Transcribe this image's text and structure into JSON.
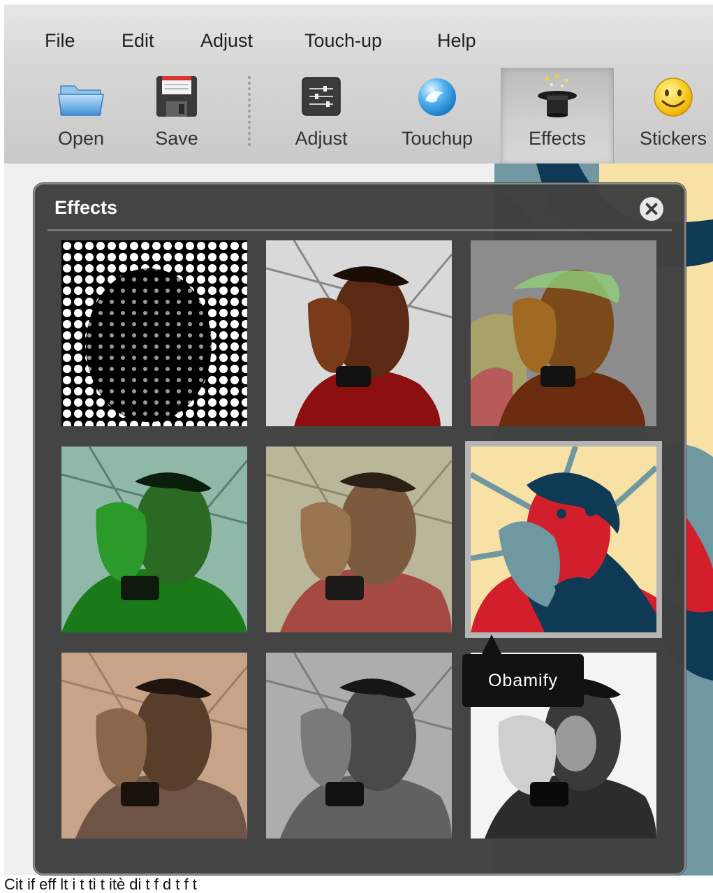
{
  "menu": {
    "items": [
      "File",
      "Edit",
      "Adjust",
      "Touch-up",
      "Help"
    ]
  },
  "toolbar": {
    "tools": [
      {
        "label": "Open",
        "icon": "folder-open-icon"
      },
      {
        "label": "Save",
        "icon": "floppy-disk-icon"
      },
      {
        "label": "Adjust",
        "icon": "sliders-icon"
      },
      {
        "label": "Touchup",
        "icon": "blue-orb-icon"
      },
      {
        "label": "Effects",
        "icon": "magic-hat-icon",
        "active": true
      },
      {
        "label": "Stickers",
        "icon": "smiley-icon"
      }
    ]
  },
  "panel": {
    "title": "Effects",
    "close_icon": "close-icon",
    "thumbnails": [
      {
        "effect": "halftone"
      },
      {
        "effect": "high-contrast"
      },
      {
        "effect": "posterize"
      },
      {
        "effect": "green-tint"
      },
      {
        "effect": "faded"
      },
      {
        "effect": "obamify",
        "selected": true
      },
      {
        "effect": "sepia"
      },
      {
        "effect": "grayscale"
      },
      {
        "effect": "sketch"
      }
    ],
    "tooltip": "Obamify"
  },
  "footer": {
    "text": "Cit if  eff    lt    i t             ti      t   itè di t    f         d      t   f t"
  },
  "colors": {
    "panel_bg": "#404040",
    "tooltip_bg": "#111111",
    "obamify_cream": "#f8e1a5",
    "obamify_red": "#d21f2b",
    "obamify_navy": "#0f3a55",
    "obamify_teal": "#6f98a0"
  }
}
